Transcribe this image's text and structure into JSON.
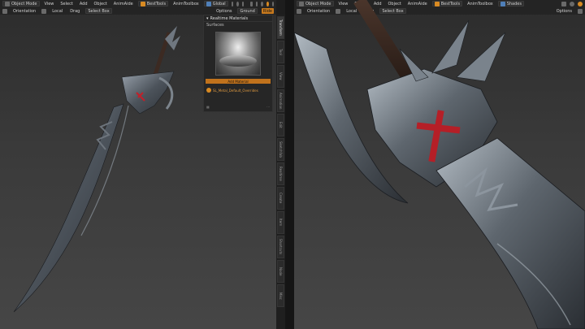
{
  "left_header": {
    "mode": "Object Mode",
    "menus": [
      "View",
      "Select",
      "Add",
      "Object",
      "AnimAide"
    ],
    "addon": "BestTools",
    "addon2": "AnimToolbox",
    "orientation": "Global",
    "overlay_options": "Options",
    "ground_button": "Ground",
    "orange_button": "Ride"
  },
  "left_header2": {
    "orientation_label": "Orientation",
    "local_label": "Local",
    "drag_label": "Drag",
    "select_box": "Select Box"
  },
  "right_header": {
    "mode": "Object Mode",
    "menus": [
      "View",
      "Select",
      "Add",
      "Object",
      "AnimAide"
    ],
    "addon": "BestTools",
    "addon2": "AnimToolbox",
    "shading": "Shades",
    "options": "Options"
  },
  "right_header2": {
    "orientation_label": "Orientation",
    "local_label": "Local",
    "drag_label": "Drag",
    "select_box": "Select Box"
  },
  "realtime_panel": {
    "title": "Realtime Materials",
    "section": "Surfaces",
    "add_button": "Add Material",
    "material_name": "SL_Metal_Default_Overrides"
  },
  "vertical_tabs": [
    "Transform",
    "Tool",
    "View",
    "Animation",
    "Edit",
    "Sketchfab",
    "Realtime",
    "Create",
    "Item",
    "Shortcuts",
    "Node",
    "Misc"
  ],
  "colors": {
    "accent": "#c87a1e",
    "header_bg": "#242424",
    "viewport_top": "#2c2c2c",
    "viewport_bottom": "#464646",
    "blade_red": "#c0202a"
  }
}
